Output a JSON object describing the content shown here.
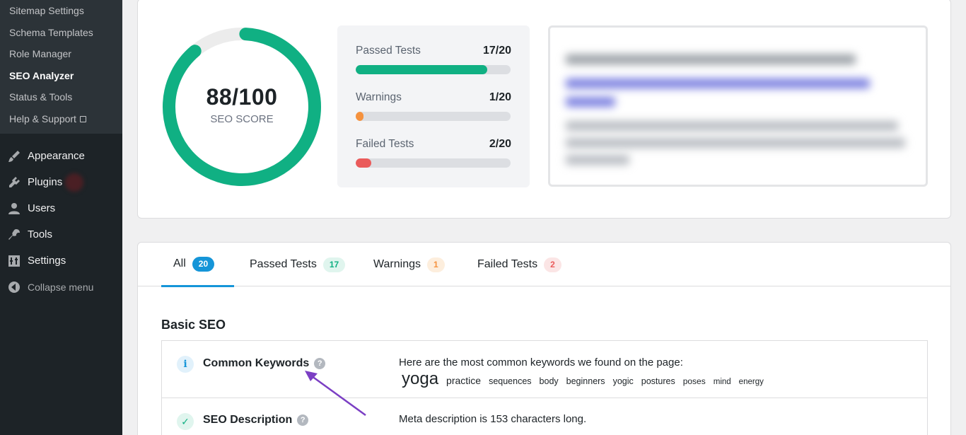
{
  "sidebar": {
    "submenu": [
      {
        "label": "Sitemap Settings",
        "current": false
      },
      {
        "label": "Schema Templates",
        "current": false
      },
      {
        "label": "Role Manager",
        "current": false
      },
      {
        "label": "SEO Analyzer",
        "current": true
      },
      {
        "label": "Status & Tools",
        "current": false
      },
      {
        "label": "Help & Support",
        "current": false,
        "icon": "external-link-icon"
      }
    ],
    "menu": [
      {
        "label": "Appearance",
        "icon": "paintbrush-icon"
      },
      {
        "label": "Plugins",
        "icon": "plugin-icon"
      },
      {
        "label": "Users",
        "icon": "user-icon"
      },
      {
        "label": "Tools",
        "icon": "wrench-icon"
      },
      {
        "label": "Settings",
        "icon": "settings-icon"
      },
      {
        "label": "Collapse menu",
        "icon": "collapse-icon"
      }
    ]
  },
  "score": {
    "value": "88/100",
    "label": "SEO SCORE",
    "fraction": 0.88,
    "color": "#10b083"
  },
  "stats": [
    {
      "label": "Passed Tests",
      "value": "17/20",
      "fraction": 0.85,
      "color": "#10b083"
    },
    {
      "label": "Warnings",
      "value": "1/20",
      "fraction": 0.05,
      "color": "#f5923e"
    },
    {
      "label": "Failed Tests",
      "value": "2/20",
      "fraction": 0.1,
      "color": "#ea5b5b"
    }
  ],
  "tabs": [
    {
      "label": "All",
      "count": "20",
      "active": true,
      "pill_bg": "#1595d8",
      "pill_fg": "#ffffff"
    },
    {
      "label": "Passed Tests",
      "count": "17",
      "active": false,
      "pill_bg": "#e0f5ee",
      "pill_fg": "#10b083"
    },
    {
      "label": "Warnings",
      "count": "1",
      "active": false,
      "pill_bg": "#fdeedd",
      "pill_fg": "#f5923e"
    },
    {
      "label": "Failed Tests",
      "count": "2",
      "active": false,
      "pill_bg": "#fbe5e5",
      "pill_fg": "#ea5b5b"
    }
  ],
  "section_title": "Basic SEO",
  "results": [
    {
      "title": "Common Keywords",
      "status": "info",
      "status_icon": "info-icon",
      "description": "Here are the most common keywords we found on the page:",
      "keywords": [
        "yoga",
        "practice",
        "sequences",
        "body",
        "beginners",
        "yogic",
        "postures",
        "poses",
        "mind",
        "energy"
      ]
    },
    {
      "title": "SEO Description",
      "status": "passed",
      "status_icon": "check-icon",
      "description": "Meta description is 153 characters long."
    }
  ]
}
